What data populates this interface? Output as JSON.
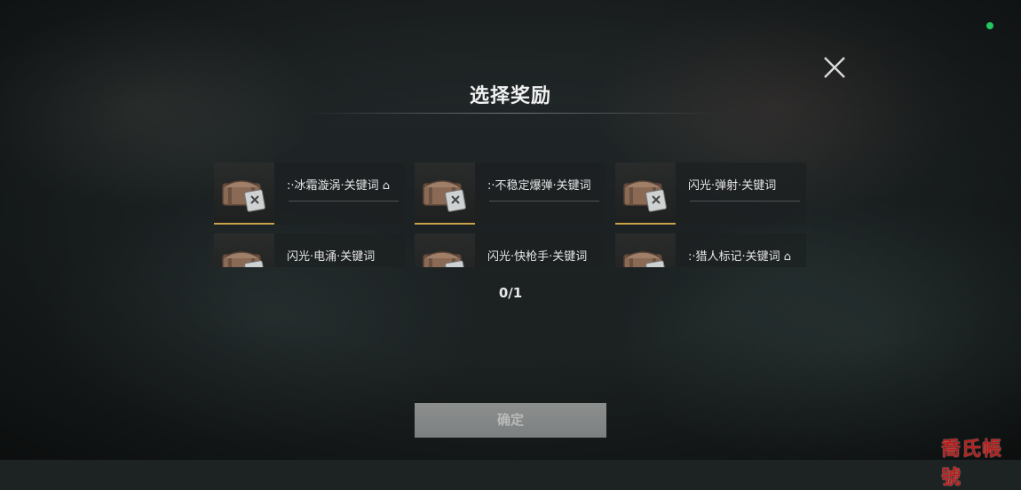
{
  "dialog": {
    "title": "选择奖励",
    "counter": "0/1",
    "confirm_label": "确定"
  },
  "rewards": [
    {
      "label": ":·冰霜漩涡·关键词 ⌂"
    },
    {
      "label": ":·不稳定爆弹·关键词"
    },
    {
      "label": "闪光·弹射·关键词"
    },
    {
      "label": "闪光·电涌·关键词"
    },
    {
      "label": "闪光·快枪手·关键词"
    },
    {
      "label": ":·猎人标记·关键词 ⌂"
    }
  ],
  "watermark": "喬氏帳號",
  "icons": [
    "close-icon",
    "reward-chest-icon"
  ],
  "colors": {
    "status_dot": "#22c55e",
    "card_accent": "#c9a24a",
    "confirm_button": "#888a8a",
    "watermark": "#c8201e"
  }
}
